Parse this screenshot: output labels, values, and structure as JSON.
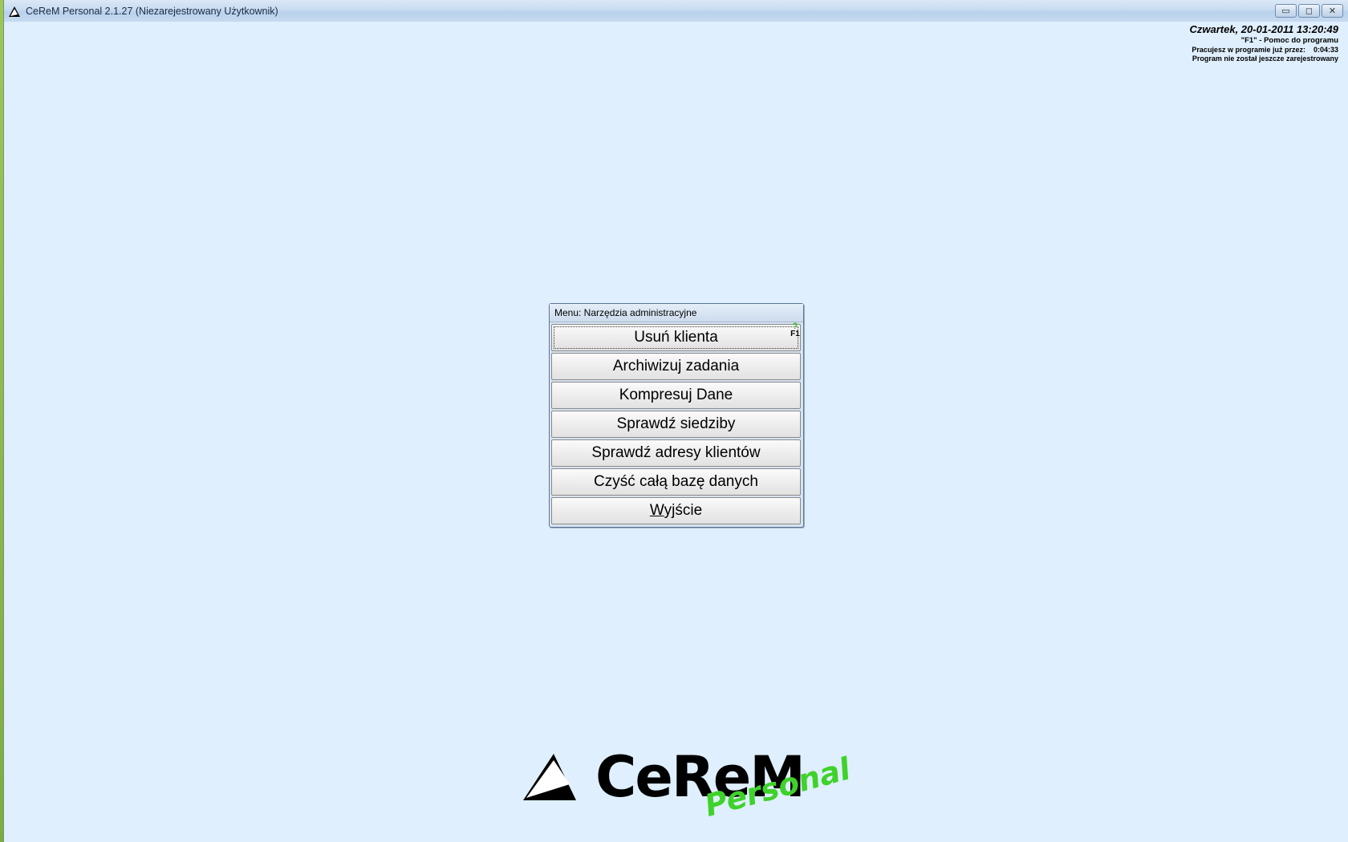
{
  "window": {
    "title": "CeReM Personal 2.1.27 (Niezarejestrowany Użytkownik)",
    "controls": {
      "minimize": "▭",
      "restore": "◻",
      "close": "✕"
    }
  },
  "status": {
    "date": "Czwartek, 20-01-2011 13:20:49",
    "help": "\"F1\" - Pomoc do programu",
    "working_label": "Pracujesz w programie już przez:",
    "working_time": "0:04:33",
    "registration": "Program nie został jeszcze zarejestrowany"
  },
  "menu": {
    "title": "Menu: Narzędzia administracyjne",
    "help_q": "?",
    "help_key": "F1",
    "items": [
      {
        "label": "Usuń klienta"
      },
      {
        "label": "Archiwizuj zadania"
      },
      {
        "label": "Kompresuj Dane"
      },
      {
        "label": "Sprawdź siedziby"
      },
      {
        "label": "Sprawdź adresy klientów"
      },
      {
        "label": "Czyść całą bazę danych"
      },
      {
        "label_first": "W",
        "label_rest": "yjście"
      }
    ]
  },
  "logo": {
    "word": "CeReM",
    "sub": "Personal",
    "colors": {
      "sub": "#3fd22a",
      "word": "#000000"
    }
  },
  "icons": {
    "app": "cerem-triangle-icon"
  }
}
